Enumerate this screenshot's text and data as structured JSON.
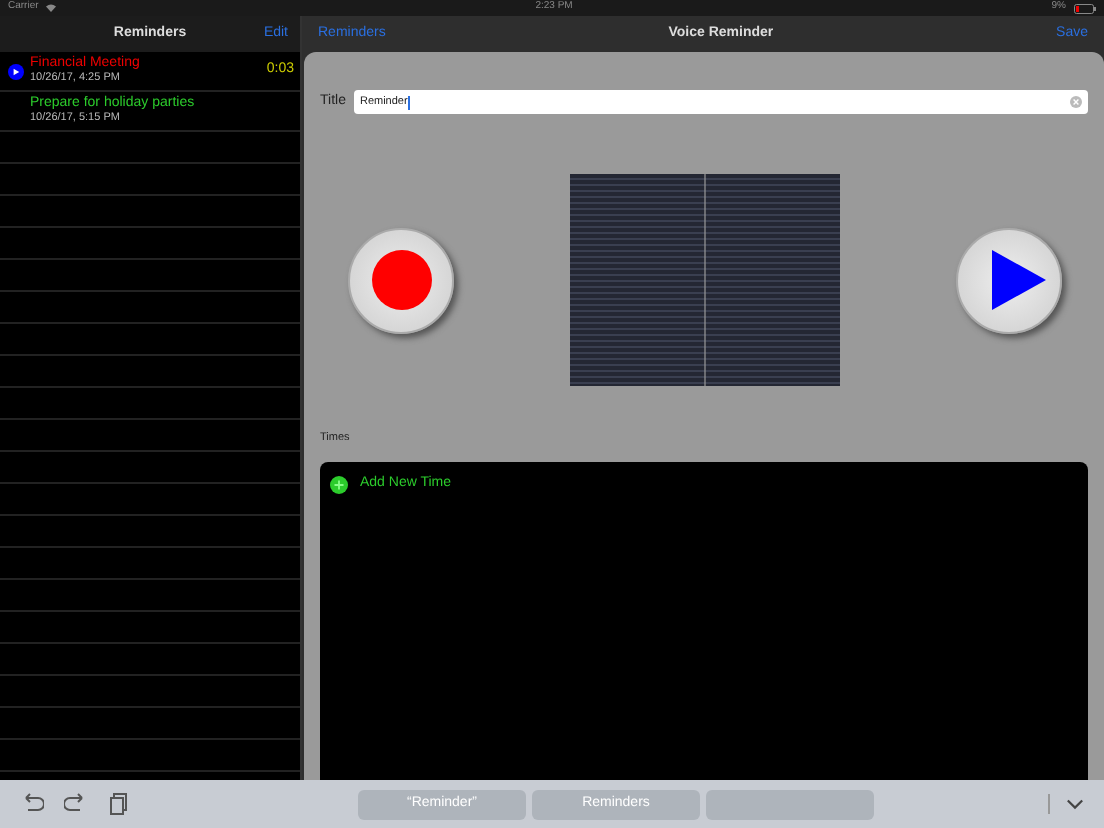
{
  "status_bar": {
    "carrier": "Carrier",
    "time": "2:23 PM",
    "battery": "9%"
  },
  "sidebar": {
    "title": "Reminders",
    "edit": "Edit",
    "items": [
      {
        "title": "Financial Meeting",
        "date": "10/26/17, 4:25 PM",
        "playing": true,
        "duration": "0:03"
      },
      {
        "title": "Prepare for holiday parties",
        "date": "10/26/17, 5:15 PM",
        "playing": false
      }
    ]
  },
  "detail": {
    "back": "Reminders",
    "title": "Voice Reminder",
    "save": "Save",
    "title_label": "Title",
    "title_value": "Reminder",
    "times_label": "Times",
    "add_time": "Add New Time"
  },
  "keyboard_bar": {
    "suggestions": [
      "“Reminder”",
      "Reminders"
    ]
  }
}
